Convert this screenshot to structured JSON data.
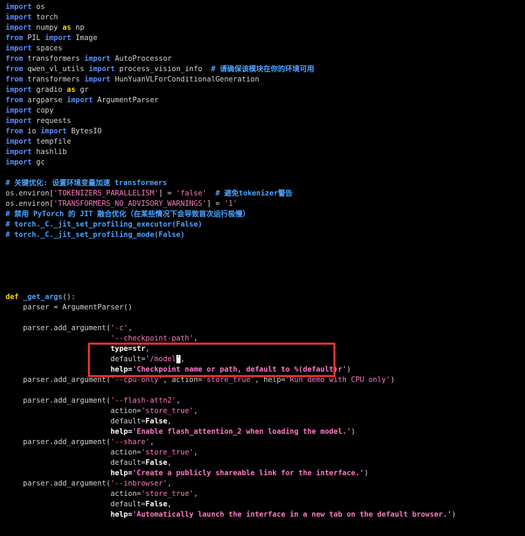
{
  "editor": {
    "lines": [
      [
        {
          "t": "import",
          "c": "kw"
        },
        {
          "t": " os",
          "c": "id"
        }
      ],
      [
        {
          "t": "import",
          "c": "kw"
        },
        {
          "t": " torch",
          "c": "id"
        }
      ],
      [
        {
          "t": "import",
          "c": "kw"
        },
        {
          "t": " numpy ",
          "c": "id"
        },
        {
          "t": "as",
          "c": "kw2"
        },
        {
          "t": " np",
          "c": "id"
        }
      ],
      [
        {
          "t": "from",
          "c": "kw"
        },
        {
          "t": " PIL ",
          "c": "id"
        },
        {
          "t": "import",
          "c": "kw"
        },
        {
          "t": " Image",
          "c": "id"
        }
      ],
      [
        {
          "t": "import",
          "c": "kw"
        },
        {
          "t": " spaces",
          "c": "id"
        }
      ],
      [
        {
          "t": "from",
          "c": "kw"
        },
        {
          "t": " transformers ",
          "c": "id"
        },
        {
          "t": "import",
          "c": "kw"
        },
        {
          "t": " AutoProcessor",
          "c": "id"
        }
      ],
      [
        {
          "t": "from",
          "c": "kw"
        },
        {
          "t": " qwen_vl_utils ",
          "c": "id"
        },
        {
          "t": "import",
          "c": "kw"
        },
        {
          "t": " process_vision_info  ",
          "c": "id"
        },
        {
          "t": "# 请确保该模块在你的环境可用",
          "c": "cm"
        }
      ],
      [
        {
          "t": "from",
          "c": "kw"
        },
        {
          "t": " transformers ",
          "c": "id"
        },
        {
          "t": "import",
          "c": "kw"
        },
        {
          "t": " HunYuanVLForConditionalGeneration",
          "c": "id"
        }
      ],
      [
        {
          "t": "import",
          "c": "kw"
        },
        {
          "t": " gradio ",
          "c": "id"
        },
        {
          "t": "as",
          "c": "kw2"
        },
        {
          "t": " gr",
          "c": "id"
        }
      ],
      [
        {
          "t": "from",
          "c": "kw"
        },
        {
          "t": " argparse ",
          "c": "id"
        },
        {
          "t": "import",
          "c": "kw"
        },
        {
          "t": " ArgumentParser",
          "c": "id"
        }
      ],
      [
        {
          "t": "import",
          "c": "kw"
        },
        {
          "t": " copy",
          "c": "id"
        }
      ],
      [
        {
          "t": "import",
          "c": "kw"
        },
        {
          "t": " requests",
          "c": "id"
        }
      ],
      [
        {
          "t": "from",
          "c": "kw"
        },
        {
          "t": " io ",
          "c": "id"
        },
        {
          "t": "import",
          "c": "kw"
        },
        {
          "t": " BytesIO",
          "c": "id"
        }
      ],
      [
        {
          "t": "import",
          "c": "kw"
        },
        {
          "t": " tempfile",
          "c": "id"
        }
      ],
      [
        {
          "t": "import",
          "c": "kw"
        },
        {
          "t": " hashlib",
          "c": "id"
        }
      ],
      [
        {
          "t": "import",
          "c": "kw"
        },
        {
          "t": " gc",
          "c": "id"
        }
      ],
      [],
      [
        {
          "t": "# 关键优化: 设置环境变量加速 transformers",
          "c": "cm"
        }
      ],
      [
        {
          "t": "os.environ[",
          "c": "id"
        },
        {
          "t": "'TOKENIZERS_PARALLELISM'",
          "c": "str"
        },
        {
          "t": "] = ",
          "c": "id"
        },
        {
          "t": "'false'",
          "c": "str"
        },
        {
          "t": "  ",
          "c": "id"
        },
        {
          "t": "# 避免tokenizer警告",
          "c": "cm"
        }
      ],
      [
        {
          "t": "os.environ[",
          "c": "id"
        },
        {
          "t": "'TRANSFORMERS_NO_ADVISORY_WARNINGS'",
          "c": "str"
        },
        {
          "t": "] = ",
          "c": "id"
        },
        {
          "t": "'1'",
          "c": "str"
        }
      ],
      [
        {
          "t": "# 禁用 PyTorch 的 JIT 融合优化（在某些情况下会导致首次运行极慢）",
          "c": "cm"
        }
      ],
      [
        {
          "t": "# torch._C._jit_set_profiling_executor(False)",
          "c": "cm"
        }
      ],
      [
        {
          "t": "# torch._C._jit_set_profiling_mode(False)",
          "c": "cm"
        }
      ],
      [],
      [],
      [],
      [],
      [],
      [
        {
          "t": "def",
          "c": "kw2"
        },
        {
          "t": " _get_args",
          "c": "cm"
        },
        {
          "t": "():",
          "c": "id"
        }
      ],
      [
        {
          "t": "    parser = ArgumentParser()",
          "c": "id"
        }
      ],
      [],
      [
        {
          "t": "    parser.add_argument(",
          "c": "id"
        },
        {
          "t": "'-c'",
          "c": "str"
        },
        {
          "t": ",",
          "c": "id"
        }
      ],
      [
        {
          "t": "                        ",
          "c": "id"
        },
        {
          "t": "'--checkpoint-path'",
          "c": "str"
        },
        {
          "t": ",",
          "c": "id"
        }
      ],
      [
        {
          "t": "                        ",
          "c": "id"
        },
        {
          "t": "type=str",
          "c": "idb"
        },
        {
          "t": ",",
          "c": "id"
        }
      ],
      [
        {
          "t": "                        ",
          "c": "id"
        },
        {
          "t": "default=",
          "c": "id"
        },
        {
          "t": "'/model",
          "c": "str"
        },
        {
          "t": "'",
          "c": "cursor"
        },
        {
          "t": ",",
          "c": "id"
        }
      ],
      [
        {
          "t": "                        ",
          "c": "id"
        },
        {
          "t": "help=",
          "c": "idb"
        },
        {
          "t": "'Checkpoint name or path, default to %(default)r'",
          "c": "strb"
        },
        {
          "t": ")",
          "c": "id"
        }
      ],
      [
        {
          "t": "    parser.add_argument(",
          "c": "id"
        },
        {
          "t": "'--cpu-only'",
          "c": "str"
        },
        {
          "t": ", action=",
          "c": "id"
        },
        {
          "t": "'store_true'",
          "c": "str"
        },
        {
          "t": ", help=",
          "c": "id"
        },
        {
          "t": "'Run demo with CPU only'",
          "c": "str"
        },
        {
          "t": ")",
          "c": "id"
        }
      ],
      [],
      [
        {
          "t": "    parser.add_argument(",
          "c": "id"
        },
        {
          "t": "'--flash-attn2'",
          "c": "str"
        },
        {
          "t": ",",
          "c": "id"
        }
      ],
      [
        {
          "t": "                        ",
          "c": "id"
        },
        {
          "t": "action=",
          "c": "id"
        },
        {
          "t": "'store_true'",
          "c": "str"
        },
        {
          "t": ",",
          "c": "id"
        }
      ],
      [
        {
          "t": "                        ",
          "c": "id"
        },
        {
          "t": "default=",
          "c": "id"
        },
        {
          "t": "False",
          "c": "idb"
        },
        {
          "t": ",",
          "c": "id"
        }
      ],
      [
        {
          "t": "                        ",
          "c": "id"
        },
        {
          "t": "help=",
          "c": "idb"
        },
        {
          "t": "'Enable flash_attention_2 when loading the model.'",
          "c": "strb"
        },
        {
          "t": ")",
          "c": "id"
        }
      ],
      [
        {
          "t": "    parser.add_argument(",
          "c": "id"
        },
        {
          "t": "'--share'",
          "c": "str"
        },
        {
          "t": ",",
          "c": "id"
        }
      ],
      [
        {
          "t": "                        ",
          "c": "id"
        },
        {
          "t": "action=",
          "c": "id"
        },
        {
          "t": "'store_true'",
          "c": "str"
        },
        {
          "t": ",",
          "c": "id"
        }
      ],
      [
        {
          "t": "                        ",
          "c": "id"
        },
        {
          "t": "default=",
          "c": "id"
        },
        {
          "t": "False",
          "c": "idb"
        },
        {
          "t": ",",
          "c": "id"
        }
      ],
      [
        {
          "t": "                        ",
          "c": "id"
        },
        {
          "t": "help=",
          "c": "idb"
        },
        {
          "t": "'Create a publicly shareable link for the interface.'",
          "c": "strb"
        },
        {
          "t": ")",
          "c": "id"
        }
      ],
      [
        {
          "t": "    parser.add_argument(",
          "c": "id"
        },
        {
          "t": "'--inbrowser'",
          "c": "str"
        },
        {
          "t": ",",
          "c": "id"
        }
      ],
      [
        {
          "t": "                        ",
          "c": "id"
        },
        {
          "t": "action=",
          "c": "id"
        },
        {
          "t": "'store_true'",
          "c": "str"
        },
        {
          "t": ",",
          "c": "id"
        }
      ],
      [
        {
          "t": "                        ",
          "c": "id"
        },
        {
          "t": "default=",
          "c": "id"
        },
        {
          "t": "False",
          "c": "idb"
        },
        {
          "t": ",",
          "c": "id"
        }
      ],
      [
        {
          "t": "                        ",
          "c": "id"
        },
        {
          "t": "help=",
          "c": "idb"
        },
        {
          "t": "'Automatically launch the interface in a new tab on the default browser.'",
          "c": "strb"
        },
        {
          "t": ")",
          "c": "id"
        }
      ]
    ]
  },
  "colors": {
    "background": "#000000",
    "keyword": "#5c8dff",
    "keyword_alt": "#ffd700",
    "comment": "#4aa3ff",
    "string": "#ff79c6",
    "highlight_box": "#e5312b"
  }
}
